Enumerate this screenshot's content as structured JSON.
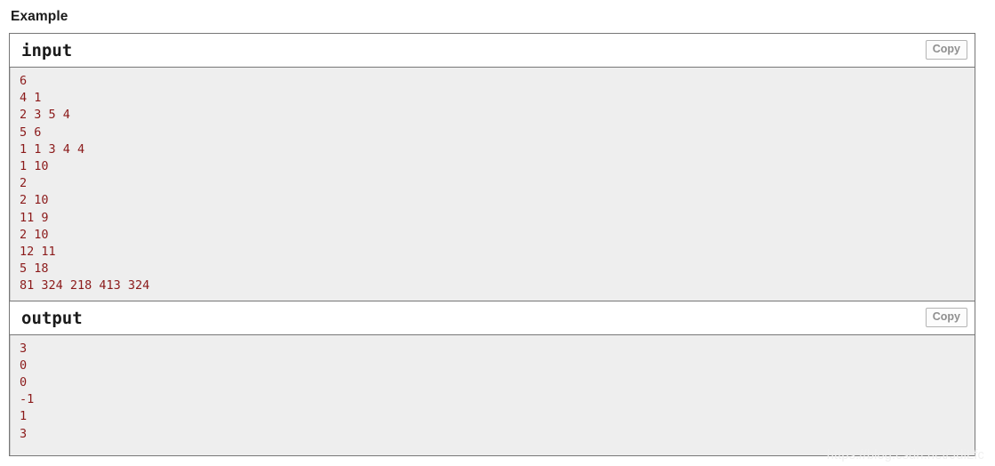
{
  "page": {
    "heading": "Example",
    "watermark": "https://blog.csdn.net/JdiLfc"
  },
  "colors": {
    "code_text": "#8b1a1a",
    "panel_border": "#777777",
    "code_background": "#eeeeee",
    "header_background": "#ffffff",
    "heading_text": "#1b1b1b",
    "copy_button_text": "#8f8f8f",
    "watermark_text": "#f0f0f0"
  },
  "sections": [
    {
      "id": "input",
      "title": "input",
      "copy_label": "Copy",
      "lines": [
        "6",
        "4 1",
        "2 3 5 4",
        "5 6",
        "1 1 3 4 4",
        "1 10",
        "2",
        "2 10",
        "11 9",
        "2 10",
        "12 11",
        "5 18",
        "81 324 218 413 324"
      ]
    },
    {
      "id": "output",
      "title": "output",
      "copy_label": "Copy",
      "lines": [
        "3",
        "0",
        "0",
        "-1",
        "1",
        "3"
      ]
    }
  ]
}
